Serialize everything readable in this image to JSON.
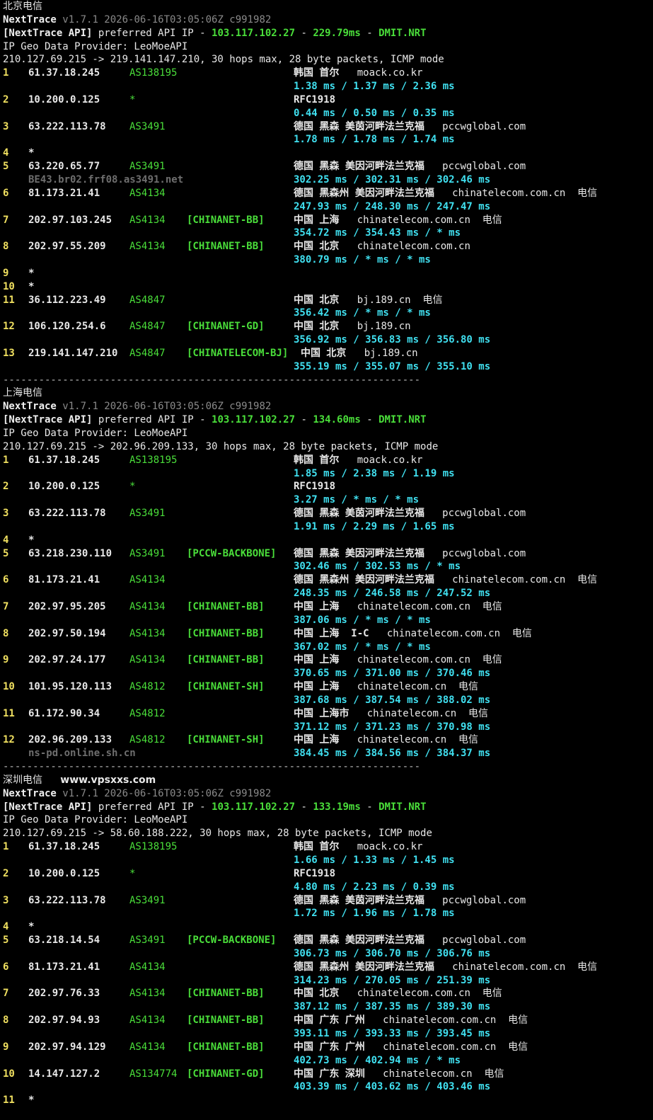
{
  "sections": [
    {
      "title": "北京电信",
      "extra": "",
      "header": {
        "app": "NextTrace",
        "version": "v1.7.1 2026-06-16T03:05:06Z c991982",
        "api_tag": "[NextTrace API]",
        "api_text": " preferred API IP - ",
        "api_ip": "103.117.102.27",
        "api_dash": " - ",
        "api_latency": "229.79ms",
        "api_dash2": " - ",
        "api_node": "DMIT.NRT",
        "geo_provider": "IP Geo Data Provider: LeoMoeAPI",
        "trace_line": "210.127.69.215 -> 219.141.147.210, 30 hops max, 28 byte packets, ICMP mode"
      },
      "hops": [
        {
          "n": "1",
          "ip": "61.37.18.245",
          "as": "AS138195",
          "tag": "",
          "geo": "韩国 首尔",
          "domain": "moack.co.kr",
          "isp": "",
          "host": "",
          "lat": "1.38 ms / 1.37 ms / 2.36 ms"
        },
        {
          "n": "2",
          "ip": "10.200.0.125",
          "as": "*",
          "tag": "",
          "geo": "RFC1918",
          "domain": "",
          "isp": "",
          "host": "",
          "lat": "0.44 ms / 0.50 ms / 0.35 ms"
        },
        {
          "n": "3",
          "ip": "63.222.113.78",
          "as": "AS3491",
          "tag": "",
          "geo": "德国 黑森 美茵河畔法兰克福",
          "domain": "pccwglobal.com",
          "isp": "",
          "host": "",
          "lat": "1.78 ms / 1.78 ms / 1.74 ms"
        },
        {
          "n": "4",
          "ip": "*",
          "as": "",
          "tag": "",
          "geo": "",
          "domain": "",
          "isp": "",
          "host": "",
          "lat": ""
        },
        {
          "n": "5",
          "ip": "63.220.65.77",
          "as": "AS3491",
          "tag": "",
          "geo": "德国 黑森 美因河畔法兰克福",
          "domain": "pccwglobal.com",
          "isp": "",
          "host": "BE43.br02.frf08.as3491.net",
          "lat": "302.25 ms / 302.31 ms / 302.46 ms"
        },
        {
          "n": "6",
          "ip": "81.173.21.41",
          "as": "AS4134",
          "tag": "",
          "geo": "德国 黑森州 美因河畔法兰克福",
          "domain": "chinatelecom.com.cn",
          "isp": "电信",
          "host": "",
          "lat": "247.93 ms / 248.30 ms / 247.47 ms"
        },
        {
          "n": "7",
          "ip": "202.97.103.245",
          "as": "AS4134",
          "tag": "[CHINANET-BB]",
          "geo": "中国 上海",
          "domain": "chinatelecom.com.cn",
          "isp": "电信",
          "host": "",
          "lat": "354.72 ms / 354.43 ms / * ms"
        },
        {
          "n": "8",
          "ip": "202.97.55.209",
          "as": "AS4134",
          "tag": "[CHINANET-BB]",
          "geo": "中国 北京",
          "domain": "chinatelecom.com.cn",
          "isp": "",
          "host": "",
          "lat": "380.79 ms / * ms / * ms"
        },
        {
          "n": "9",
          "ip": "*",
          "as": "",
          "tag": "",
          "geo": "",
          "domain": "",
          "isp": "",
          "host": "",
          "lat": ""
        },
        {
          "n": "10",
          "ip": "*",
          "as": "",
          "tag": "",
          "geo": "",
          "domain": "",
          "isp": "",
          "host": "",
          "lat": ""
        },
        {
          "n": "11",
          "ip": "36.112.223.49",
          "as": "AS4847",
          "tag": "",
          "geo": "中国 北京",
          "domain": "bj.189.cn",
          "isp": "电信",
          "host": "",
          "lat": "356.42 ms / * ms / * ms"
        },
        {
          "n": "12",
          "ip": "106.120.254.6",
          "as": "AS4847",
          "tag": "[CHINANET-GD]",
          "geo": "中国 北京",
          "domain": "bj.189.cn",
          "isp": "",
          "host": "",
          "lat": "356.92 ms / 356.83 ms / 356.80 ms"
        },
        {
          "n": "13",
          "ip": "219.141.147.210",
          "as": "AS4847",
          "tag": "[CHINATELECOM-BJ]",
          "geo": "中国 北京",
          "domain": "bj.189.cn",
          "isp": "",
          "host": "",
          "lat": "355.19 ms / 355.07 ms / 355.10 ms"
        }
      ]
    },
    {
      "title": "上海电信",
      "extra": "",
      "header": {
        "app": "NextTrace",
        "version": "v1.7.1 2026-06-16T03:05:06Z c991982",
        "api_tag": "[NextTrace API]",
        "api_text": " preferred API IP - ",
        "api_ip": "103.117.102.27",
        "api_dash": " - ",
        "api_latency": "134.60ms",
        "api_dash2": " - ",
        "api_node": "DMIT.NRT",
        "geo_provider": "IP Geo Data Provider: LeoMoeAPI",
        "trace_line": "210.127.69.215 -> 202.96.209.133, 30 hops max, 28 byte packets, ICMP mode"
      },
      "hops": [
        {
          "n": "1",
          "ip": "61.37.18.245",
          "as": "AS138195",
          "tag": "",
          "geo": "韩国 首尔",
          "domain": "moack.co.kr",
          "isp": "",
          "host": "",
          "lat": "1.85 ms / 2.38 ms / 1.19 ms"
        },
        {
          "n": "2",
          "ip": "10.200.0.125",
          "as": "*",
          "tag": "",
          "geo": "RFC1918",
          "domain": "",
          "isp": "",
          "host": "",
          "lat": "3.27 ms / * ms / * ms"
        },
        {
          "n": "3",
          "ip": "63.222.113.78",
          "as": "AS3491",
          "tag": "",
          "geo": "德国 黑森 美茵河畔法兰克福",
          "domain": "pccwglobal.com",
          "isp": "",
          "host": "",
          "lat": "1.91 ms / 2.29 ms / 1.65 ms"
        },
        {
          "n": "4",
          "ip": "*",
          "as": "",
          "tag": "",
          "geo": "",
          "domain": "",
          "isp": "",
          "host": "",
          "lat": ""
        },
        {
          "n": "5",
          "ip": "63.218.230.110",
          "as": "AS3491",
          "tag": "[PCCW-BACKBONE]",
          "geo": "德国 黑森 美因河畔法兰克福",
          "domain": "pccwglobal.com",
          "isp": "",
          "host": "",
          "lat": "302.46 ms / 302.53 ms / * ms"
        },
        {
          "n": "6",
          "ip": "81.173.21.41",
          "as": "AS4134",
          "tag": "",
          "geo": "德国 黑森州 美因河畔法兰克福",
          "domain": "chinatelecom.com.cn",
          "isp": "电信",
          "host": "",
          "lat": "248.35 ms / 246.58 ms / 247.52 ms"
        },
        {
          "n": "7",
          "ip": "202.97.95.205",
          "as": "AS4134",
          "tag": "[CHINANET-BB]",
          "geo": "中国 上海",
          "domain": "chinatelecom.com.cn",
          "isp": "电信",
          "host": "",
          "lat": "387.06 ms / * ms / * ms"
        },
        {
          "n": "8",
          "ip": "202.97.50.194",
          "as": "AS4134",
          "tag": "[CHINANET-BB]",
          "geo": "中国 上海  I-C",
          "domain": "chinatelecom.com.cn",
          "isp": "电信",
          "host": "",
          "lat": "367.02 ms / * ms / * ms"
        },
        {
          "n": "9",
          "ip": "202.97.24.177",
          "as": "AS4134",
          "tag": "[CHINANET-BB]",
          "geo": "中国 上海",
          "domain": "chinatelecom.com.cn",
          "isp": "电信",
          "host": "",
          "lat": "370.65 ms / 371.00 ms / 370.46 ms"
        },
        {
          "n": "10",
          "ip": "101.95.120.113",
          "as": "AS4812",
          "tag": "[CHINANET-SH]",
          "geo": "中国 上海",
          "domain": "chinatelecom.cn",
          "isp": "电信",
          "host": "",
          "lat": "387.68 ms / 387.54 ms / 388.02 ms"
        },
        {
          "n": "11",
          "ip": "61.172.90.34",
          "as": "AS4812",
          "tag": "",
          "geo": "中国 上海市",
          "domain": "chinatelecom.cn",
          "isp": "电信",
          "host": "",
          "lat": "371.12 ms / 371.23 ms / 370.98 ms"
        },
        {
          "n": "12",
          "ip": "202.96.209.133",
          "as": "AS4812",
          "tag": "[CHINANET-SH]",
          "geo": "中国 上海",
          "domain": "chinatelecom.cn",
          "isp": "电信",
          "host": "ns-pd.online.sh.cn",
          "lat": "384.45 ms / 384.56 ms / 384.37 ms"
        }
      ]
    },
    {
      "title": "深圳电信",
      "extra": "www.vpsxxs.com",
      "header": {
        "app": "NextTrace",
        "version": "v1.7.1 2026-06-16T03:05:06Z c991982",
        "api_tag": "[NextTrace API]",
        "api_text": " preferred API IP - ",
        "api_ip": "103.117.102.27",
        "api_dash": " - ",
        "api_latency": "133.19ms",
        "api_dash2": " - ",
        "api_node": "DMIT.NRT",
        "geo_provider": "IP Geo Data Provider: LeoMoeAPI",
        "trace_line": "210.127.69.215 -> 58.60.188.222, 30 hops max, 28 byte packets, ICMP mode"
      },
      "hops": [
        {
          "n": "1",
          "ip": "61.37.18.245",
          "as": "AS138195",
          "tag": "",
          "geo": "韩国 首尔",
          "domain": "moack.co.kr",
          "isp": "",
          "host": "",
          "lat": "1.66 ms / 1.33 ms / 1.45 ms"
        },
        {
          "n": "2",
          "ip": "10.200.0.125",
          "as": "*",
          "tag": "",
          "geo": "RFC1918",
          "domain": "",
          "isp": "",
          "host": "",
          "lat": "4.80 ms / 2.23 ms / 0.39 ms"
        },
        {
          "n": "3",
          "ip": "63.222.113.78",
          "as": "AS3491",
          "tag": "",
          "geo": "德国 黑森 美茵河畔法兰克福",
          "domain": "pccwglobal.com",
          "isp": "",
          "host": "",
          "lat": "1.72 ms / 1.96 ms / 1.78 ms"
        },
        {
          "n": "4",
          "ip": "*",
          "as": "",
          "tag": "",
          "geo": "",
          "domain": "",
          "isp": "",
          "host": "",
          "lat": ""
        },
        {
          "n": "5",
          "ip": "63.218.14.54",
          "as": "AS3491",
          "tag": "[PCCW-BACKBONE]",
          "geo": "德国 黑森 美因河畔法兰克福",
          "domain": "pccwglobal.com",
          "isp": "",
          "host": "",
          "lat": "306.73 ms / 306.70 ms / 306.76 ms"
        },
        {
          "n": "6",
          "ip": "81.173.21.41",
          "as": "AS4134",
          "tag": "",
          "geo": "德国 黑森州 美因河畔法兰克福",
          "domain": "chinatelecom.com.cn",
          "isp": "电信",
          "host": "",
          "lat": "314.23 ms / 270.05 ms / 251.39 ms"
        },
        {
          "n": "7",
          "ip": "202.97.76.33",
          "as": "AS4134",
          "tag": "[CHINANET-BB]",
          "geo": "中国 北京",
          "domain": "chinatelecom.com.cn",
          "isp": "电信",
          "host": "",
          "lat": "387.12 ms / 387.35 ms / 389.30 ms"
        },
        {
          "n": "8",
          "ip": "202.97.94.93",
          "as": "AS4134",
          "tag": "[CHINANET-BB]",
          "geo": "中国 广东 广州",
          "domain": "chinatelecom.com.cn",
          "isp": "电信",
          "host": "",
          "lat": "393.11 ms / 393.33 ms / 393.45 ms"
        },
        {
          "n": "9",
          "ip": "202.97.94.129",
          "as": "AS4134",
          "tag": "[CHINANET-BB]",
          "geo": "中国 广东 广州",
          "domain": "chinatelecom.com.cn",
          "isp": "电信",
          "host": "",
          "lat": "402.73 ms / 402.94 ms / * ms"
        },
        {
          "n": "10",
          "ip": "14.147.127.2",
          "as": "AS134774",
          "tag": "[CHINANET-GD]",
          "geo": "中国 广东 深圳",
          "domain": "chinatelecom.cn",
          "isp": "电信",
          "host": "",
          "lat": "403.39 ms / 403.62 ms / 403.46 ms"
        },
        {
          "n": "11",
          "ip": "*",
          "as": "",
          "tag": "",
          "geo": "",
          "domain": "",
          "isp": "",
          "host": "",
          "lat": ""
        }
      ]
    }
  ],
  "separator": "----------------------------------------------------------------------"
}
